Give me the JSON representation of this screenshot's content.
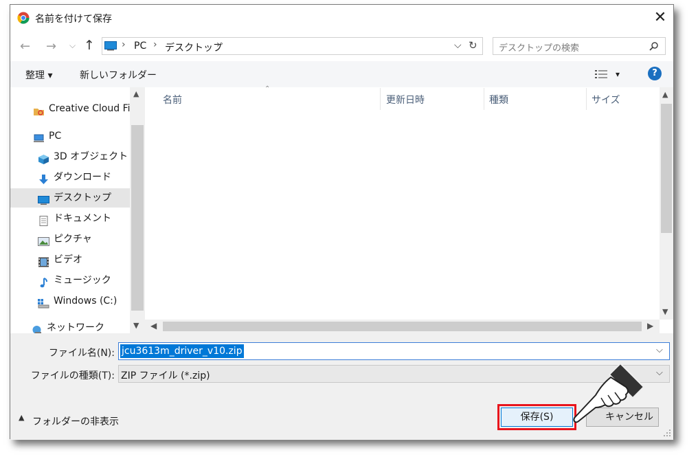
{
  "window": {
    "title": "名前を付けて保存",
    "close_label": "✕"
  },
  "address": {
    "segments": [
      "PC",
      "デスクトップ"
    ],
    "search_placeholder": "デスクトップの検索"
  },
  "toolbar": {
    "organize": "整理 ▾",
    "new_folder": "新しいフォルダー",
    "view_caret": "▾",
    "help": "?"
  },
  "sidebar": {
    "items": [
      {
        "label": "Creative Cloud Files",
        "icon": "creative-cloud-icon"
      },
      {
        "label": "PC",
        "icon": "pc-icon"
      },
      {
        "label": "3D オブジェクト",
        "icon": "3d-objects-icon"
      },
      {
        "label": "ダウンロード",
        "icon": "download-icon"
      },
      {
        "label": "デスクトップ",
        "icon": "desktop-icon",
        "selected": true
      },
      {
        "label": "ドキュメント",
        "icon": "document-icon"
      },
      {
        "label": "ピクチャ",
        "icon": "pictures-icon"
      },
      {
        "label": "ビデオ",
        "icon": "video-icon"
      },
      {
        "label": "ミュージック",
        "icon": "music-icon"
      },
      {
        "label": "Windows (C:)",
        "icon": "drive-icon"
      },
      {
        "label": "ネットワーク",
        "icon": "network-icon"
      }
    ]
  },
  "columns": [
    {
      "label": "名前"
    },
    {
      "label": "更新日時"
    },
    {
      "label": "種類"
    },
    {
      "label": "サイズ"
    }
  ],
  "form": {
    "filename_label": "ファイル名(N):",
    "filename_value": "jcu3613m_driver_v10.zip",
    "filetype_label": "ファイルの種類(T):",
    "filetype_value": "ZIP ファイル (*.zip)"
  },
  "footer": {
    "hide_folders": "フォルダーの非表示",
    "save": "保存(S)",
    "cancel": "キャンセル"
  },
  "colors": {
    "accent": "#0078d7",
    "highlight": "#e8141c",
    "help": "#1a6fc0"
  }
}
